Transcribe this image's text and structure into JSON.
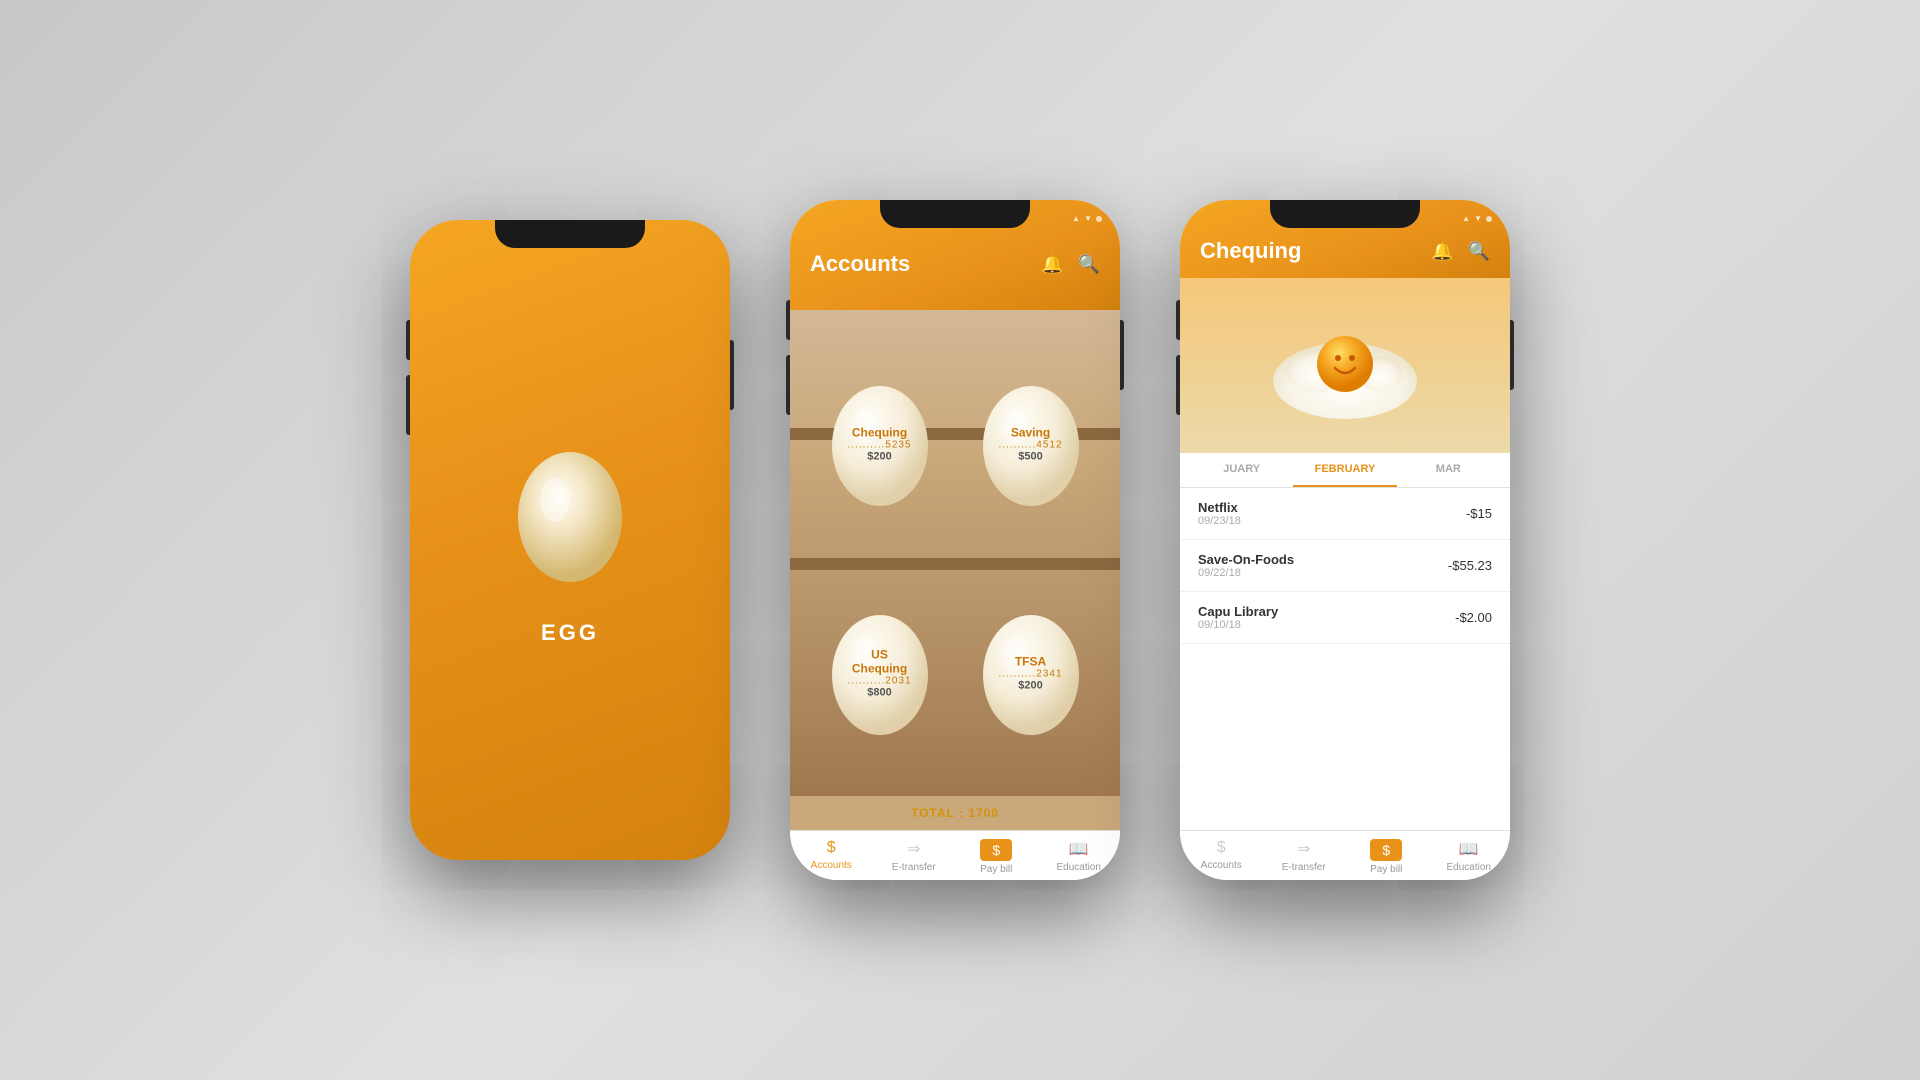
{
  "background": "#d4d4d4",
  "phone1": {
    "type": "splash",
    "app_name": "EGG",
    "egg_icon": "egg"
  },
  "phone2": {
    "type": "accounts",
    "header": {
      "title": "Accounts",
      "bell_icon": "bell",
      "search_icon": "search"
    },
    "accounts": [
      {
        "name": "Chequing",
        "number": "..........5235",
        "amount": "$200"
      },
      {
        "name": "Saving",
        "number": "..........4512",
        "amount": "$500"
      },
      {
        "name": "US Chequing",
        "number": "..........2031",
        "amount": "$800"
      },
      {
        "name": "TFSA",
        "number": "..........2341",
        "amount": "$200"
      }
    ],
    "total_label": "TOTAL : 1700",
    "tab_bar": {
      "items": [
        {
          "label": "Accounts",
          "icon": "$",
          "active": true
        },
        {
          "label": "E-transfer",
          "icon": "⇒",
          "active": false
        },
        {
          "label": "Pay bill",
          "icon": "$",
          "active": false,
          "boxed": true
        },
        {
          "label": "Education",
          "icon": "📖",
          "active": false
        }
      ]
    }
  },
  "phone3": {
    "type": "chequing",
    "header": {
      "title": "Chequing",
      "bell_icon": "bell",
      "search_icon": "search"
    },
    "months": [
      {
        "label": "JUARY",
        "active": false
      },
      {
        "label": "FEBRUARY",
        "active": true
      },
      {
        "label": "MAR",
        "active": false
      }
    ],
    "transactions": [
      {
        "merchant": "Netflix",
        "date": "09/23/18",
        "amount": "-$15"
      },
      {
        "merchant": "Save-On-Foods",
        "date": "09/22/18",
        "amount": "-$55.23"
      },
      {
        "merchant": "Capu Library",
        "date": "09/10/18",
        "amount": "-$2.00"
      }
    ],
    "tab_bar": {
      "items": [
        {
          "label": "Accounts",
          "icon": "$",
          "active": false
        },
        {
          "label": "E-transfer",
          "icon": "⇒",
          "active": false
        },
        {
          "label": "Pay bill",
          "icon": "$",
          "active": false,
          "boxed": true
        },
        {
          "label": "Education",
          "icon": "📖",
          "active": false
        }
      ]
    }
  }
}
